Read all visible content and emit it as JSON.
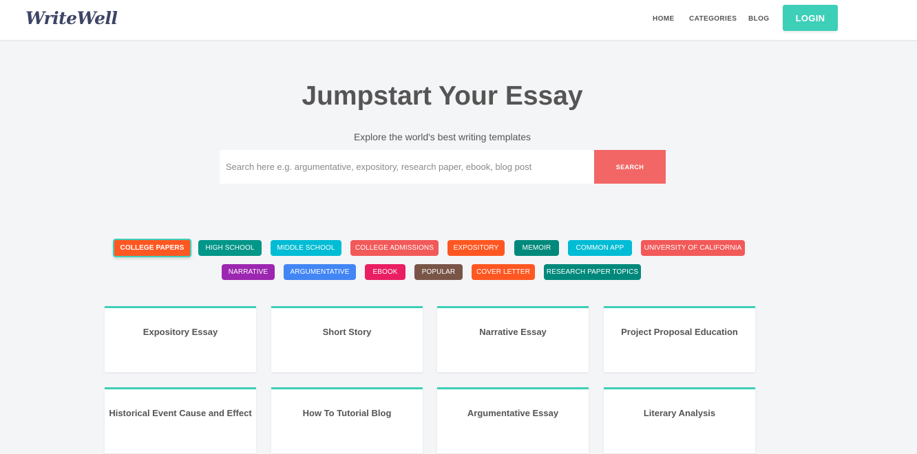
{
  "header": {
    "logo": "WriteWell",
    "nav": [
      "HOME",
      "CATEGORIES",
      "BLOG"
    ],
    "login_label": "LOGIN"
  },
  "hero": {
    "title": "Jumpstart Your Essay",
    "subtitle": "Explore the world's best writing templates",
    "search_placeholder": "Search here e.g. argumentative, expository, research paper, ebook, blog post",
    "search_value": "",
    "search_button": "SEARCH"
  },
  "categories": [
    {
      "label": "COLLEGE PAPERS",
      "color": "#ff5722",
      "active": true
    },
    {
      "label": "HIGH SCHOOL",
      "color": "#009688"
    },
    {
      "label": "MIDDLE SCHOOL",
      "color": "#00bcd4"
    },
    {
      "label": "COLLEGE ADMISSIONS",
      "color": "#f25959"
    },
    {
      "label": "EXPOSITORY",
      "color": "#ff5722"
    },
    {
      "label": "MEMOIR",
      "color": "#00897b"
    },
    {
      "label": "COMMON APP",
      "color": "#00bcd4"
    },
    {
      "label": "UNIVERSITY OF CALIFORNIA",
      "color": "#f25959"
    },
    {
      "label": "NARRATIVE",
      "color": "#9c27b0"
    },
    {
      "label": "ARGUMENTATIVE",
      "color": "#4285f4"
    },
    {
      "label": "EBOOK",
      "color": "#e91e63"
    },
    {
      "label": "POPULAR",
      "color": "#795548"
    },
    {
      "label": "COVER LETTER",
      "color": "#ff5722"
    },
    {
      "label": "RESEARCH PAPER TOPICS",
      "color": "#00897b"
    }
  ],
  "templates": [
    "Expository Essay",
    "Short Story",
    "Narrative Essay",
    "Project Proposal Education",
    "Historical Event Cause and Effect",
    "How To Tutorial Blog",
    "Argumentative Essay",
    "Literary Analysis"
  ],
  "colors": {
    "accent": "#3ecfb8",
    "search_button": "#f26666",
    "background": "#f4f5f7"
  }
}
